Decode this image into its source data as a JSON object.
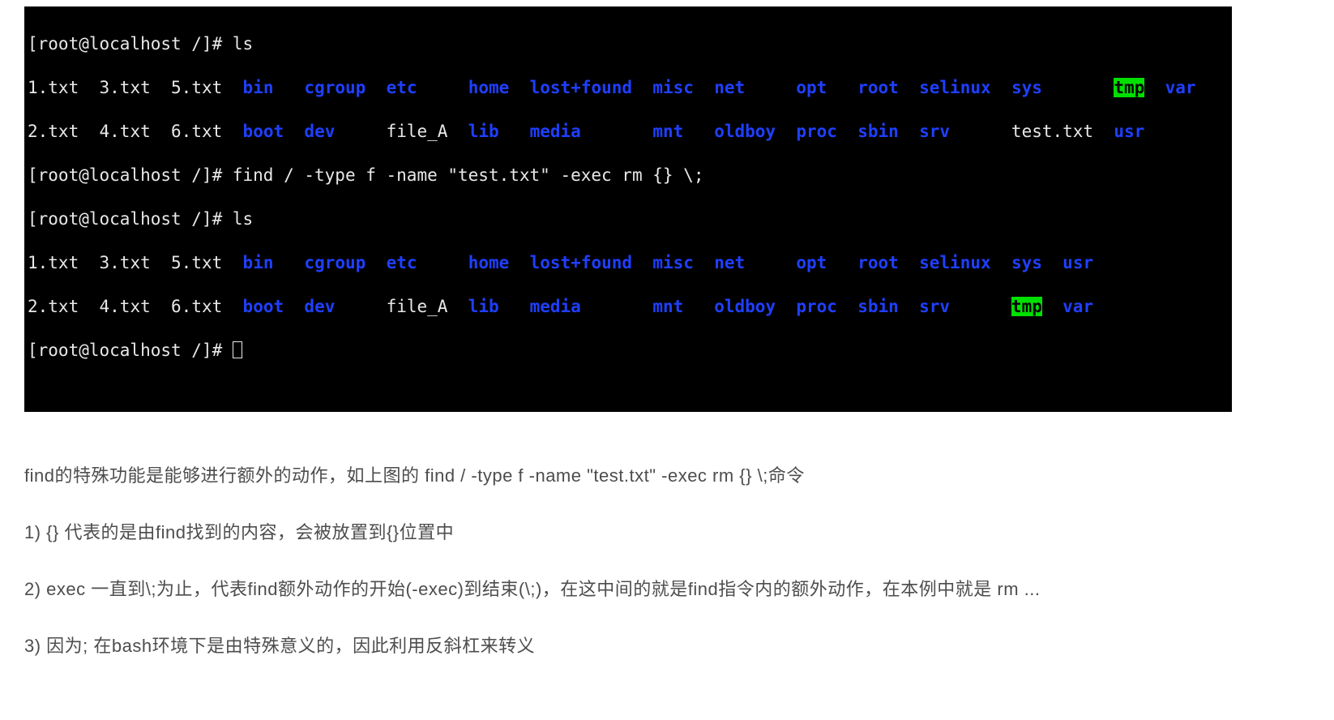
{
  "terminal": {
    "prompt": "[root@localhost /]# ",
    "cmd_ls": "ls",
    "cmd_find": "find / -type f -name \"test.txt\" -exec rm {} \\;",
    "ls1_row1": {
      "c01": "1.txt",
      "c02": "3.txt",
      "c03": "5.txt",
      "c04": "bin",
      "c05": "cgroup",
      "c06": "etc",
      "c07": "home",
      "c08": "lost+found",
      "c09": "misc",
      "c10": "net",
      "c11": "opt",
      "c12": "root",
      "c13": "selinux",
      "c14": "sys",
      "c15": "tmp",
      "c16": "var"
    },
    "ls1_row2": {
      "c01": "2.txt",
      "c02": "4.txt",
      "c03": "6.txt",
      "c04": "boot",
      "c05": "dev",
      "c06": "file_A",
      "c07": "lib",
      "c08": "media",
      "c09": "mnt",
      "c10": "oldboy",
      "c11": "proc",
      "c12": "sbin",
      "c13": "srv",
      "c14": "test.txt",
      "c15": "usr"
    },
    "ls2_row1": {
      "c01": "1.txt",
      "c02": "3.txt",
      "c03": "5.txt",
      "c04": "bin",
      "c05": "cgroup",
      "c06": "etc",
      "c07": "home",
      "c08": "lost+found",
      "c09": "misc",
      "c10": "net",
      "c11": "opt",
      "c12": "root",
      "c13": "selinux",
      "c14": "sys",
      "c15": "usr"
    },
    "ls2_row2": {
      "c01": "2.txt",
      "c02": "4.txt",
      "c03": "6.txt",
      "c04": "boot",
      "c05": "dev",
      "c06": "file_A",
      "c07": "lib",
      "c08": "media",
      "c09": "mnt",
      "c10": "oldboy",
      "c11": "proc",
      "c12": "sbin",
      "c13": "srv",
      "c14": "tmp",
      "c15": "var"
    }
  },
  "article": {
    "p1": "find的特殊功能是能够进行额外的动作，如上图的 find / -type f -name \"test.txt\" -exec rm {} \\;命令",
    "p2": "1) {} 代表的是由find找到的内容，会被放置到{}位置中",
    "p3": "2) exec 一直到\\;为止，代表find额外动作的开始(-exec)到结束(\\;)，在这中间的就是find指令内的额外动作，在本例中就是 rm ...",
    "p4": "3) 因为; 在bash环境下是由特殊意义的，因此利用反斜杠来转义"
  }
}
